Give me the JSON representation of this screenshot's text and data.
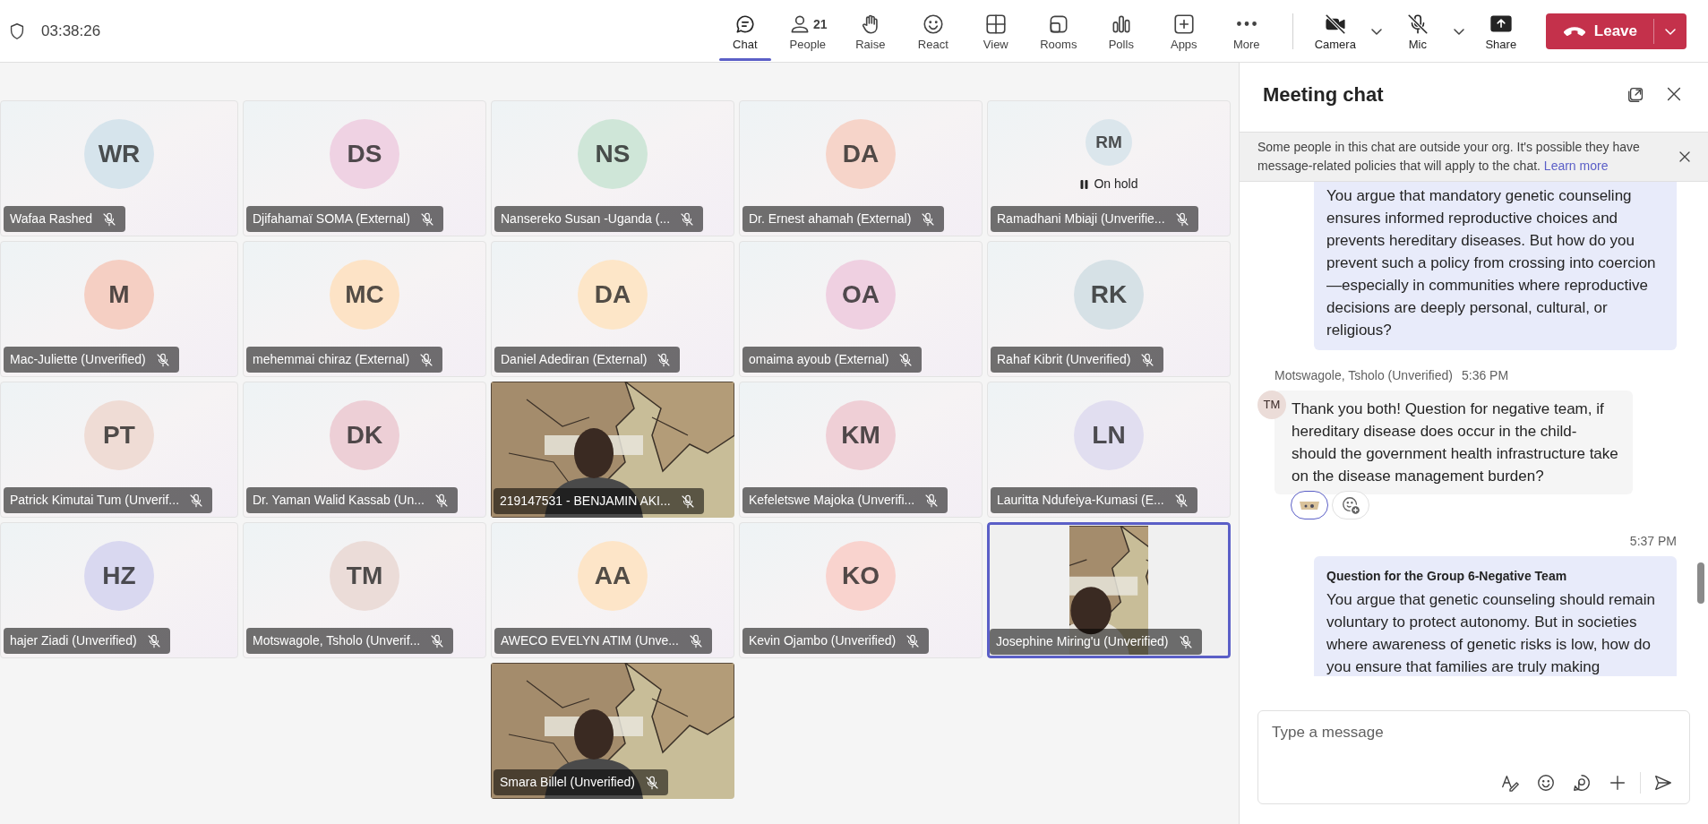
{
  "top_bar": {
    "timer": "03:38:26"
  },
  "toolbar": [
    {
      "label": "Chat",
      "selected": true
    },
    {
      "label": "People",
      "badge": "21",
      "selected": false
    },
    {
      "label": "Raise",
      "selected": false
    },
    {
      "label": "React",
      "selected": false
    },
    {
      "label": "View",
      "selected": false
    },
    {
      "label": "Rooms",
      "selected": false
    },
    {
      "label": "Polls",
      "selected": false
    },
    {
      "label": "Apps",
      "selected": false
    },
    {
      "label": "More",
      "selected": false
    }
  ],
  "devices": [
    {
      "label": "Camera",
      "on": false
    },
    {
      "label": "Mic",
      "on": false
    }
  ],
  "share": {
    "label": "Share"
  },
  "leave": {
    "label": "Leave"
  },
  "tiles": [
    {
      "kind": "avatar",
      "name": "Wafaa Rashed",
      "initials": "WR",
      "color": "#d6e4ec",
      "muted": true
    },
    {
      "kind": "avatar",
      "name": "Djifahamaï SOMA (External)",
      "initials": "DS",
      "color": "#efd2e3",
      "muted": true
    },
    {
      "kind": "avatar",
      "name": "Nansereko Susan -Uganda (...",
      "initials": "NS",
      "color": "#cfe6d8",
      "muted": true
    },
    {
      "kind": "avatar",
      "name": "Dr. Ernest ahamah (External)",
      "initials": "DA",
      "color": "#f6d4c9",
      "muted": true
    },
    {
      "kind": "avatar",
      "name": "Ramadhani Mbiaji (Unverifie...",
      "initials": "RM",
      "color": "#dbe6ec",
      "muted": true,
      "status": "On hold"
    },
    {
      "kind": "avatar",
      "name": "Mac-Juliette (Unverified)",
      "initials": "M",
      "color": "#f5cfc3",
      "muted": true
    },
    {
      "kind": "avatar",
      "name": "mehemmai chiraz (External)",
      "initials": "MC",
      "color": "#fde3c6",
      "muted": true
    },
    {
      "kind": "avatar",
      "name": "Daniel Adediran (External)",
      "initials": "DA",
      "color": "#fde6c8",
      "muted": true
    },
    {
      "kind": "avatar",
      "name": "omaima ayoub (External)",
      "initials": "OA",
      "color": "#efd0e1",
      "muted": true
    },
    {
      "kind": "avatar",
      "name": "Rahaf Kibrit (Unverified)",
      "initials": "RK",
      "color": "#d6e1e6",
      "muted": true
    },
    {
      "kind": "avatar",
      "name": "Patrick Kimutai Tum (Unverif...",
      "initials": "PT",
      "color": "#efdcd5",
      "muted": true
    },
    {
      "kind": "avatar",
      "name": "Dr. Yaman Walid Kassab (Un...",
      "initials": "DK",
      "color": "#edcfd6",
      "muted": true
    },
    {
      "kind": "video",
      "name": "219147531 - BENJAMIN AKI...",
      "muted": true
    },
    {
      "kind": "avatar",
      "name": "Kefeletswe Majoka (Unverifi...",
      "initials": "KM",
      "color": "#efcfd6",
      "muted": true
    },
    {
      "kind": "avatar",
      "name": "Lauritta Ndufeiya-Kumasi (E...",
      "initials": "LN",
      "color": "#e1def0",
      "muted": true
    },
    {
      "kind": "avatar",
      "name": "hajer Ziadi (Unverified)",
      "initials": "HZ",
      "color": "#d9d8f0",
      "muted": true
    },
    {
      "kind": "avatar",
      "name": "Motswagole, Tsholo (Unverif...",
      "initials": "TM",
      "color": "#ebdcd8",
      "muted": true
    },
    {
      "kind": "avatar",
      "name": "AWECO EVELYN ATIM (Unve...",
      "initials": "AA",
      "color": "#fde5c8",
      "muted": true
    },
    {
      "kind": "avatar",
      "name": "Kevin Ojambo (Unverified)",
      "initials": "KO",
      "color": "#f9d3ce",
      "muted": true
    },
    {
      "kind": "small_video",
      "name": "Josephine Miring'u (Unverified)",
      "muted": true,
      "speaking": true
    },
    {
      "kind": "video",
      "name": "Smara Billel (Unverified)",
      "muted": true
    }
  ],
  "chat": {
    "title": "Meeting chat",
    "banner": {
      "text": "Some people in this chat are outside your org. It's possible they have message-related policies that will apply to the chat.",
      "link": "Learn more"
    },
    "messages": [
      {
        "kind": "own",
        "body": "You argue that mandatory genetic counseling ensures informed reproductive choices and prevents hereditary diseases. But how do you prevent such a policy from crossing into coercion—especially in communities where reproductive decisions are deeply personal, cultural, or religious?"
      },
      {
        "kind": "other",
        "author": "Motswagole, Tsholo (Unverified)",
        "time": "5:36 PM",
        "initials": "TM",
        "body": "Thank you both! Question for negative team, if hereditary disease does occur in the child-should the government health infrastructure take on the disease management burden?",
        "reactions": [
          {
            "selected": true
          }
        ]
      },
      {
        "kind": "own",
        "time": "5:37 PM",
        "heading": "Question for the Group 6-Negative Team",
        "body": "You argue that genetic counseling should remain voluntary to protect autonomy. But in societies where awareness of genetic risks is low, how do you ensure that families are truly making"
      }
    ],
    "compose": {
      "placeholder": "Type a message"
    }
  }
}
